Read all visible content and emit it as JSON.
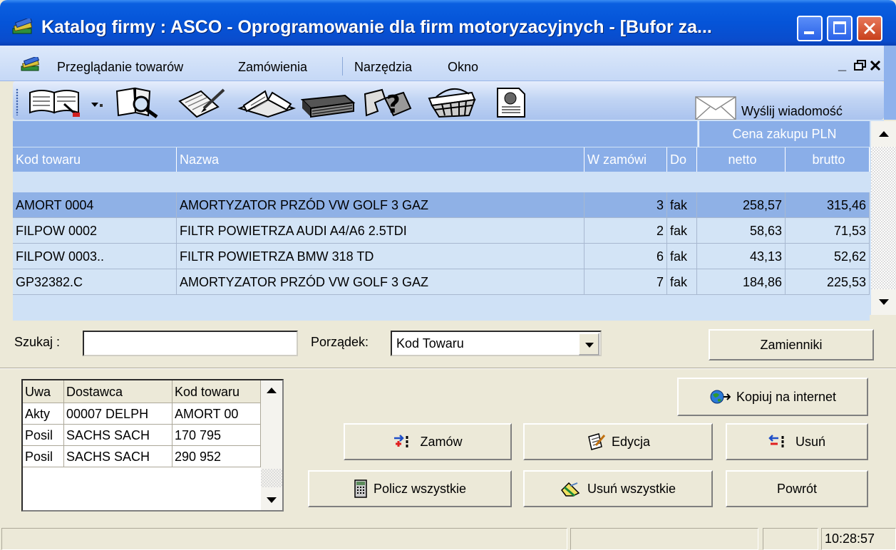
{
  "window": {
    "title": "Katalog firmy : ASCO - Oprogramowanie dla firm motoryzacyjnych - [Bufor za..."
  },
  "menu": {
    "items": [
      "Przeglądanie towarów",
      "Zamówienia",
      "Narzędzia",
      "Okno"
    ],
    "mdi_min": "_",
    "mdi_restore": "Ɖ",
    "mdi_close": "×"
  },
  "toolbar": {
    "icons": [
      "catalog-book-icon",
      "magnifier-book-icon",
      "notepad-pen-icon",
      "open-book-icon",
      "ledger-icon",
      "help-puzzle-icon",
      "basket-icon",
      "document-globe-icon"
    ],
    "send_message_label": "Wyślij wiadomość"
  },
  "grid": {
    "group_header": "Cena zakupu PLN",
    "columns": [
      "Kod towaru",
      "Nazwa",
      "W zamówi",
      "Do",
      "netto",
      "brutto"
    ],
    "rows": [
      {
        "kod": "AMORT 0004",
        "nazwa": "AMORTYZATOR PRZÓD VW GOLF 3 GAZ",
        "ilosc": "3",
        "do": "fak",
        "netto": "258,57",
        "brutto": "315,46",
        "selected": true
      },
      {
        "kod": "FILPOW 0002",
        "nazwa": "FILTR POWIETRZA AUDI A4/A6 2.5TDI",
        "ilosc": "2",
        "do": "fak",
        "netto": "58,63",
        "brutto": "71,53",
        "selected": false
      },
      {
        "kod": "FILPOW 0003..",
        "nazwa": "FILTR POWIETRZA BMW 318 TD",
        "ilosc": "6",
        "do": "fak",
        "netto": "43,13",
        "brutto": "52,62",
        "selected": false
      },
      {
        "kod": "GP32382.C",
        "nazwa": "AMORTYZATOR PRZÓD VW GOLF 3 GAZ",
        "ilosc": "7",
        "do": "fak",
        "netto": "184,86",
        "brutto": "225,53",
        "selected": false
      }
    ]
  },
  "search": {
    "label": "Szukaj :",
    "value": "",
    "order_label": "Porządek:",
    "order_value": "Kod Towaru",
    "replacements_button": "Zamienniki"
  },
  "suppliers": {
    "columns": [
      "Uwa",
      "Dostawca",
      "Kod towaru"
    ],
    "rows": [
      [
        "Akty",
        "00007 DELPH",
        "AMORT 00"
      ],
      [
        "Posil",
        "SACHS SACH",
        "170 795"
      ],
      [
        "Posil",
        "SACHS SACH",
        "290 952"
      ]
    ]
  },
  "actions": {
    "copy_internet": "Kopiuj na internet",
    "order": "Zamów",
    "edit": "Edycja",
    "delete": "Usuń",
    "count_all": "Policz wszystkie",
    "delete_all": "Usuń wszystkie",
    "back": "Powrót"
  },
  "status": {
    "time": "10:28:57"
  },
  "colors": {
    "titlebar": "#0554d8",
    "grid_header": "#8aaee8",
    "row_selected": "#8fb1e6",
    "row_normal": "#d3e4f6",
    "dialog_bg": "#ece9d8"
  }
}
